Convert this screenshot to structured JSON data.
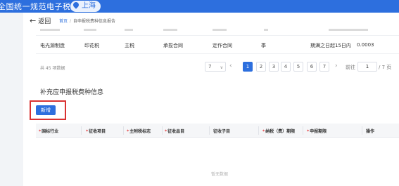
{
  "header": {
    "site_title": "全国统一规范电子税务局",
    "region": "上海",
    "bar_color": "#2d6fde"
  },
  "nav": {
    "back_label": "返回",
    "breadcrumb_home": "首页",
    "breadcrumb_sep": "/",
    "breadcrumb_current": "自申报税费种信息报告"
  },
  "table": {
    "row": {
      "industry": "电光源制造",
      "tax_item": "印花税",
      "main_flag": "主税",
      "collection_item": "承揽合同",
      "collection_subitem": "定作合同",
      "period": "季",
      "deadline": "期满之日起15日内",
      "rate": "0.0003"
    }
  },
  "pagination": {
    "total_text": "共 45 项数据",
    "page_size": "7",
    "pages": [
      "1",
      "2",
      "3",
      "4",
      "5",
      "6",
      "7"
    ],
    "active_page": "1",
    "jump_label": "前往",
    "jump_value": "1",
    "total_pages": "/ 7 页"
  },
  "supplement": {
    "title": "补充应申报税费种信息",
    "add_button": "新增",
    "columns": [
      {
        "label": "国标行业",
        "required": true
      },
      {
        "label": "征收项目",
        "required": true
      },
      {
        "label": "主附税标志",
        "required": true
      },
      {
        "label": "征收品目",
        "required": true
      },
      {
        "label": "征收子目",
        "required": false
      },
      {
        "label": "纳税（费）期限",
        "required": true
      },
      {
        "label": "申报期限",
        "required": true
      },
      {
        "label": "操作",
        "required": false
      }
    ],
    "empty_text": "暂无数据"
  }
}
